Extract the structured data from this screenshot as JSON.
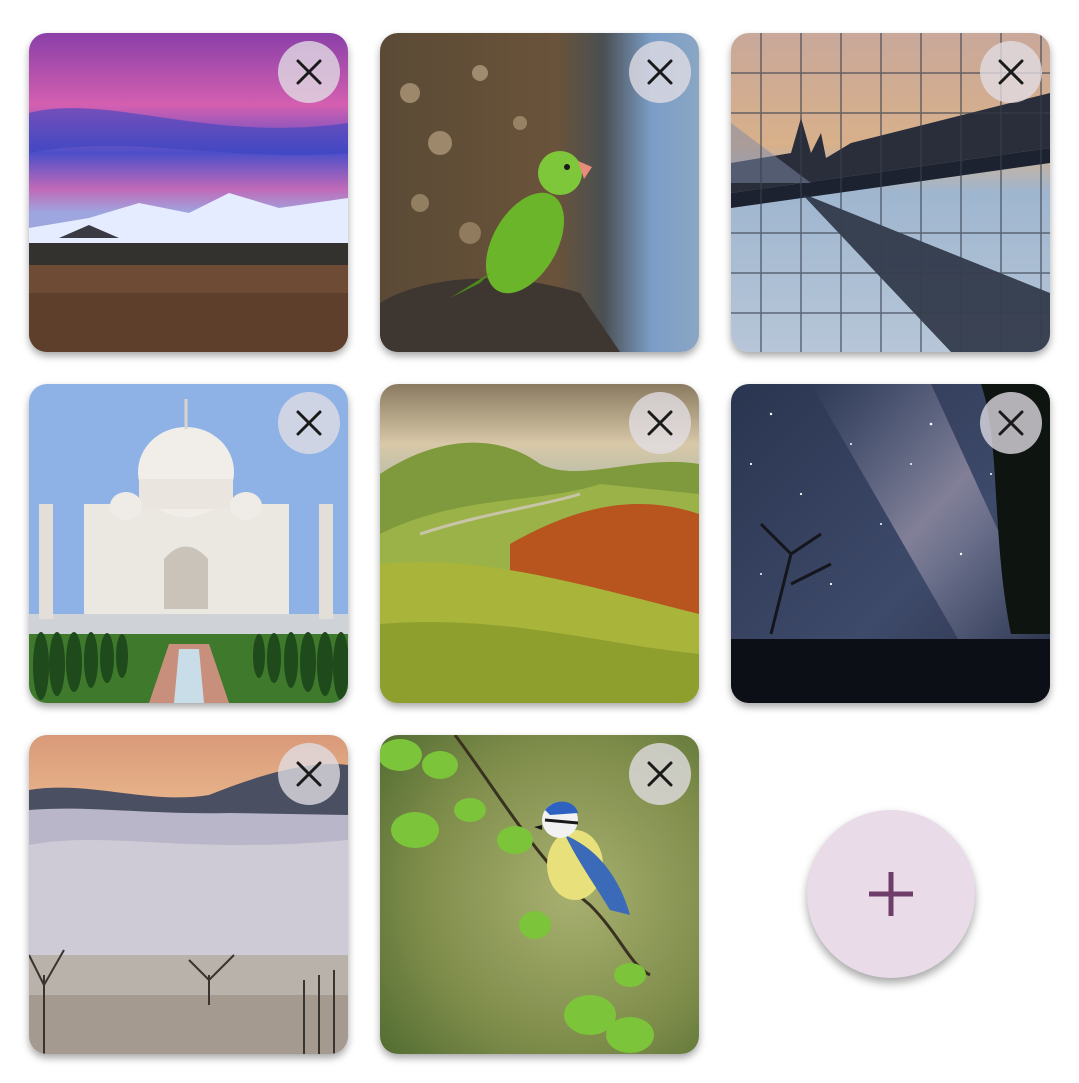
{
  "colors": {
    "close_button_bg": "#e1dee4",
    "close_icon": "#1a1a1a",
    "add_button_bg": "#e9dbe8",
    "add_icon": "#6e3d6a"
  },
  "grid": {
    "photos": [
      {
        "subject": "mountain-sunset",
        "close_icon": "close-icon"
      },
      {
        "subject": "green-parakeet",
        "close_icon": "close-icon"
      },
      {
        "subject": "glass-building-reflection",
        "close_icon": "close-icon"
      },
      {
        "subject": "taj-mahal",
        "close_icon": "close-icon"
      },
      {
        "subject": "green-hills-autumn",
        "close_icon": "close-icon"
      },
      {
        "subject": "milky-way-night",
        "close_icon": "close-icon"
      },
      {
        "subject": "foggy-valley",
        "close_icon": "close-icon"
      },
      {
        "subject": "blue-tit-branch",
        "close_icon": "close-icon"
      }
    ]
  },
  "add_button": {
    "icon": "plus-icon"
  }
}
